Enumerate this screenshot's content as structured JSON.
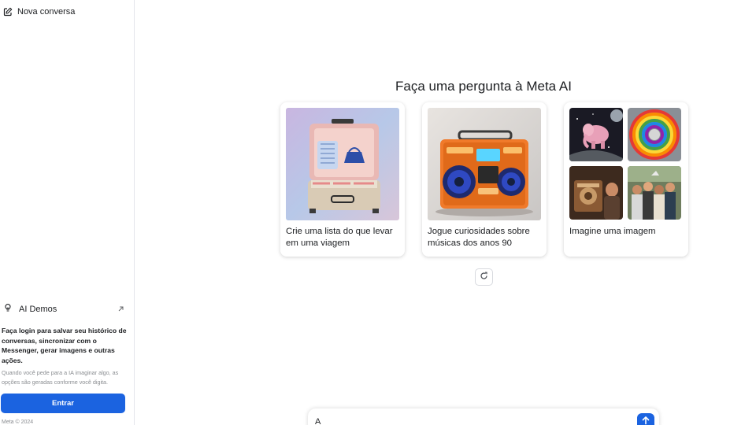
{
  "sidebar": {
    "new_chat_label": "Nova conversa",
    "ai_demos_label": "AI Demos",
    "login_text": "Faça login para salvar seu histórico de conversas, sincronizar com o Messenger, gerar imagens e outras ações.",
    "login_note": "Quando você pede para a IA imaginar algo, as opções são geradas conforme você digita.",
    "login_button": "Entrar",
    "copyright": "Meta © 2024"
  },
  "main": {
    "title": "Faça uma pergunta à Meta AI",
    "cards": [
      {
        "caption": "Crie uma lista do que levar em uma viagem",
        "image": "suitcase-image"
      },
      {
        "caption": "Jogue curiosidades sobre músicas dos anos 90",
        "image": "boombox-image"
      },
      {
        "caption": "Imagine uma imagem",
        "image": "collage-image"
      }
    ],
    "refresh_icon": "refresh-icon"
  },
  "composer": {
    "value": "A",
    "send_icon": "arrow-up-icon"
  },
  "colors": {
    "accent": "#1b63e0",
    "text": "#1c1e21",
    "muted": "#8a8d91"
  }
}
